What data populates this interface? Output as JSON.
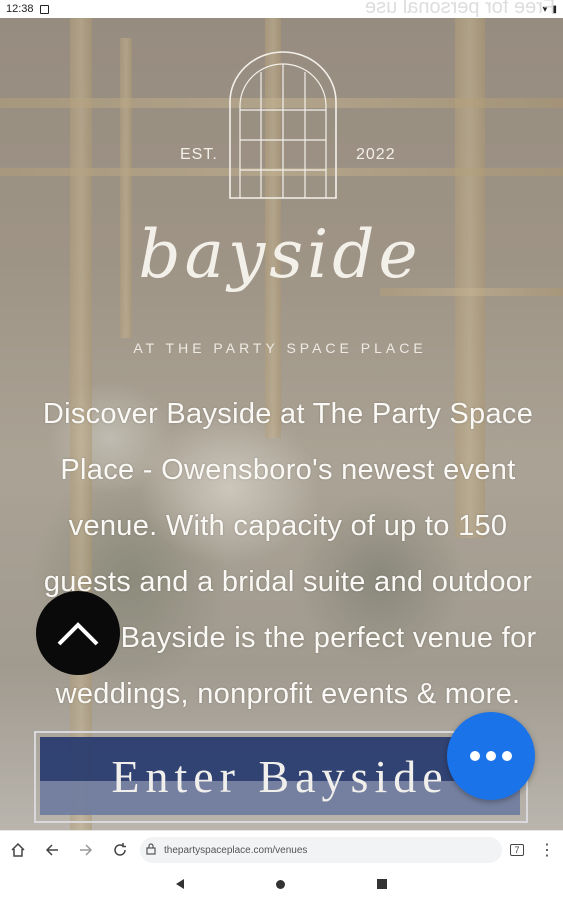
{
  "status_bar": {
    "time": "12:38"
  },
  "watermark": "Free for personal use",
  "logo": {
    "est": "EST.",
    "year": "2022",
    "script_name": "bayside",
    "tagline": "AT THE PARTY SPACE PLACE"
  },
  "hero": {
    "description_lines": [
      "Discover Bayside at The Party Space",
      "Place - Owensboro's newest event",
      "venue. With capacity of up to 150",
      "guests and a bridal suite and outdoor",
      "patio, Bayside is the perfect venue for",
      "weddings, nonprofit events & more."
    ],
    "cta_label": "Enter Bayside"
  },
  "browser": {
    "url": "thepartyspaceplace.com/venues",
    "tab_count": "7"
  },
  "colors": {
    "cta_background": "#23376e",
    "fab_background": "#1a73e8",
    "scroll_button": "#0a0a0a"
  }
}
